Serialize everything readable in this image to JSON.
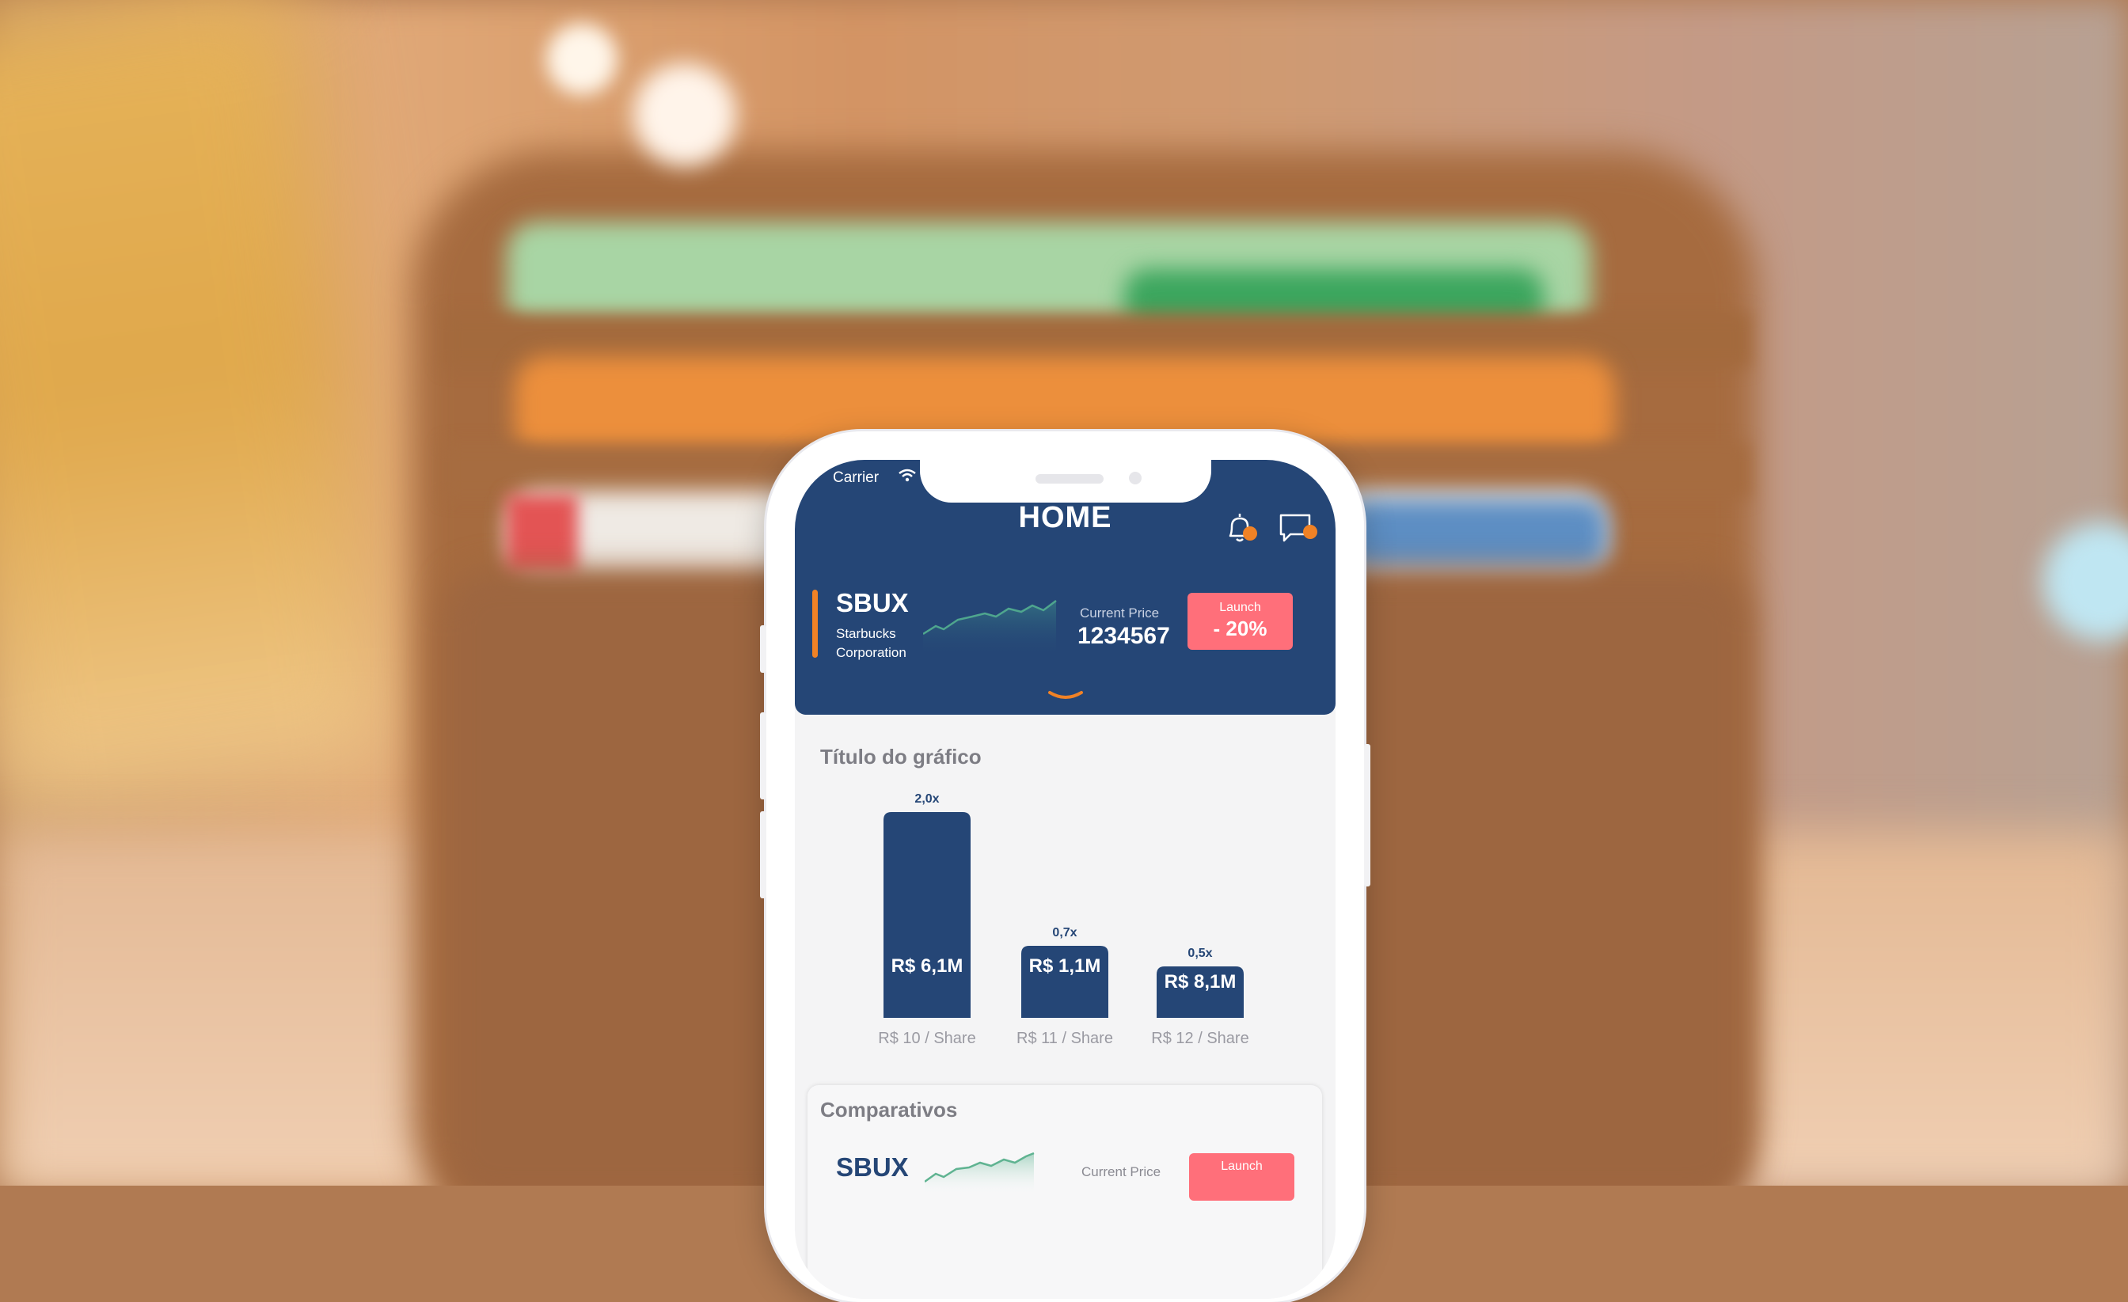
{
  "status_bar": {
    "carrier": "Carrier"
  },
  "header": {
    "title": "HOME",
    "icons": [
      "bell-icon",
      "chat-bubble-icon"
    ],
    "notification_color": "#f08226"
  },
  "stock": {
    "ticker": "SBUX",
    "company": "Starbucks Corporation",
    "current_price_label": "Current Price",
    "current_price_value": "1234567",
    "launch_label": "Launch",
    "launch_value": "- 20%"
  },
  "chart": {
    "title": "Título do gráfico"
  },
  "chart_data": {
    "type": "bar",
    "categories": [
      "R$ 10 / Share",
      "R$ 11 / Share",
      "R$ 12 / Share"
    ],
    "values": [
      2.0,
      0.7,
      0.5
    ],
    "top_labels": [
      "2,0x",
      "0,7x",
      "0,5x"
    ],
    "bar_labels": [
      "R$ 6,1M",
      "R$ 1,1M",
      "R$ 8,1M"
    ],
    "title": "Título do gráfico",
    "xlabel": "",
    "ylabel": "",
    "bar_color": "#254676"
  },
  "comparativos": {
    "title": "Comparativos",
    "ticker": "SBUX",
    "current_price_label": "Current Price",
    "launch_label": "Launch"
  },
  "colors": {
    "primary": "#254676",
    "accent": "#f08226",
    "launch": "#ff6f7a"
  }
}
